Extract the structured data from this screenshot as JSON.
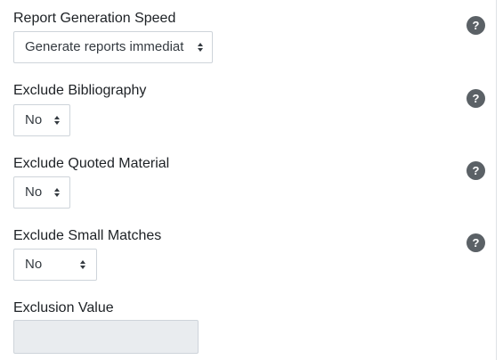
{
  "fields": {
    "speed": {
      "label": "Report Generation Speed",
      "value": "Generate reports immediat",
      "help_icon": "question-circle-icon"
    },
    "bibliography": {
      "label": "Exclude Bibliography",
      "value": "No",
      "help_icon": "question-circle-icon"
    },
    "quoted": {
      "label": "Exclude Quoted Material",
      "value": "No",
      "help_icon": "question-circle-icon"
    },
    "small": {
      "label": "Exclude Small Matches",
      "value": "No",
      "help_icon": "question-circle-icon"
    },
    "exclusion": {
      "label": "Exclusion Value",
      "value": ""
    }
  },
  "help_glyph": "?",
  "colors": {
    "help_icon_bg": "#5b6166",
    "disabled_input_bg": "#e9ecef",
    "border": "#ced4da"
  }
}
